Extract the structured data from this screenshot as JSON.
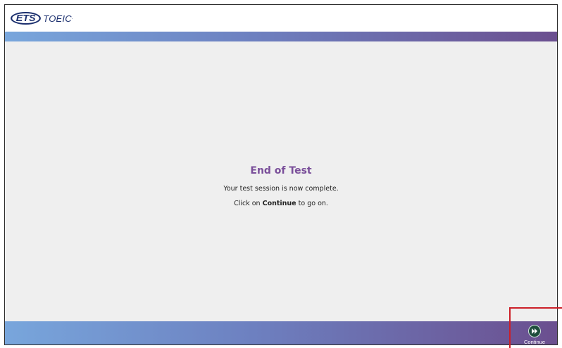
{
  "header": {
    "logo_ets": "ETS",
    "logo_toeic": "TOEIC",
    "logo_mark": "."
  },
  "main": {
    "title": "End of Test",
    "line1": "Your test session is now complete.",
    "line2_prefix": "Click on ",
    "line2_bold": "Continue",
    "line2_suffix": " to go on."
  },
  "footer": {
    "continue_label": "Continue",
    "continue_icon": "fast-forward-icon"
  },
  "colors": {
    "title": "#7a4f9a",
    "bar_start": "#78a6dc",
    "bar_end": "#6b4f8f",
    "continue_icon_bg": "#1e4d3c",
    "highlight": "#cc1f28"
  }
}
